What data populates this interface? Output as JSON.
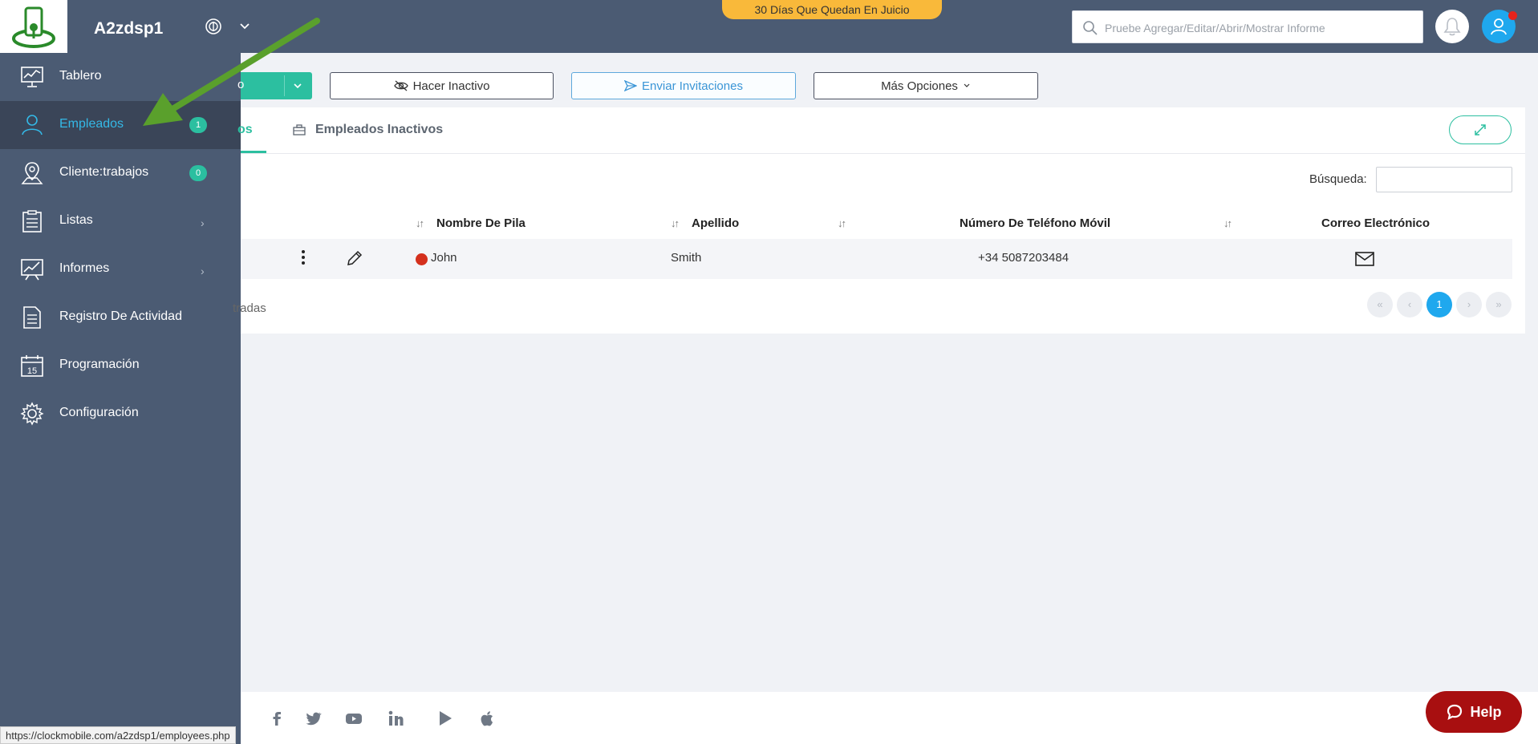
{
  "header": {
    "company_name": "A2zdsp1",
    "trial_banner": "30 Días Que Quedan En Juicio",
    "search_placeholder": "Pruebe Agregar/Editar/Abrir/Mostrar Informe",
    "icons": [
      "logo-icon",
      "currency-icon",
      "chevron-down-icon",
      "search-icon",
      "bell-icon",
      "user-icon"
    ]
  },
  "sidebar": {
    "items": [
      {
        "label": "Tablero",
        "icon": "dashboard-icon"
      },
      {
        "label": "Empleados",
        "icon": "users-icon",
        "badge": "1",
        "active": true
      },
      {
        "label": "Cliente:trabajos",
        "icon": "map-pin-icon",
        "badge": "0"
      },
      {
        "label": "Listas",
        "icon": "list-icon",
        "chevron": "›"
      },
      {
        "label": "Informes",
        "icon": "chart-icon",
        "chevron": "›"
      },
      {
        "label": "Registro De Actividad",
        "icon": "document-icon"
      },
      {
        "label": "Programación",
        "icon": "calendar-icon",
        "calendar_day": "15"
      },
      {
        "label": "Configuración",
        "icon": "gear-icon"
      }
    ]
  },
  "toolbar": {
    "green_button_label": "o",
    "make_inactive_label": "Hacer Inactivo",
    "send_invites_label": "Enviar Invitaciones",
    "more_options_label": "Más Opciones"
  },
  "tabs": {
    "active_label": "os",
    "inactive_label": "Empleados Inactivos"
  },
  "table": {
    "search_label": "Búsqueda:",
    "search_value": "",
    "sort_glyph": "↓↑",
    "columns": [
      "Nombre De Pila",
      "Apellido",
      "Número De Teléfono Móvil",
      "Correo Electrónico"
    ],
    "rows": [
      {
        "first_name": "John",
        "last_name": "Smith",
        "mobile": "+34 5087203484",
        "status_color": "#d4301d"
      }
    ],
    "entries_text": "tradas",
    "pagination": {
      "first": "«",
      "prev": "‹",
      "current": "1",
      "next": "›",
      "last": "»"
    }
  },
  "footer": {
    "social_icons": [
      "facebook-icon",
      "twitter-icon",
      "youtube-icon",
      "linkedin-icon",
      "play-store-icon",
      "apple-icon"
    ],
    "help_label": "Help"
  },
  "status_bar": {
    "url": "https://clockmobile.com/a2zdsp1/employees.php"
  },
  "colors": {
    "sidebar_bg": "#4b5b73",
    "accent_green": "#2cbfa0",
    "accent_blue": "#1fa8ee",
    "trial_yellow": "#f9b93a",
    "help_red": "#a80f10",
    "annotation_arrow": "#5aa02c"
  }
}
